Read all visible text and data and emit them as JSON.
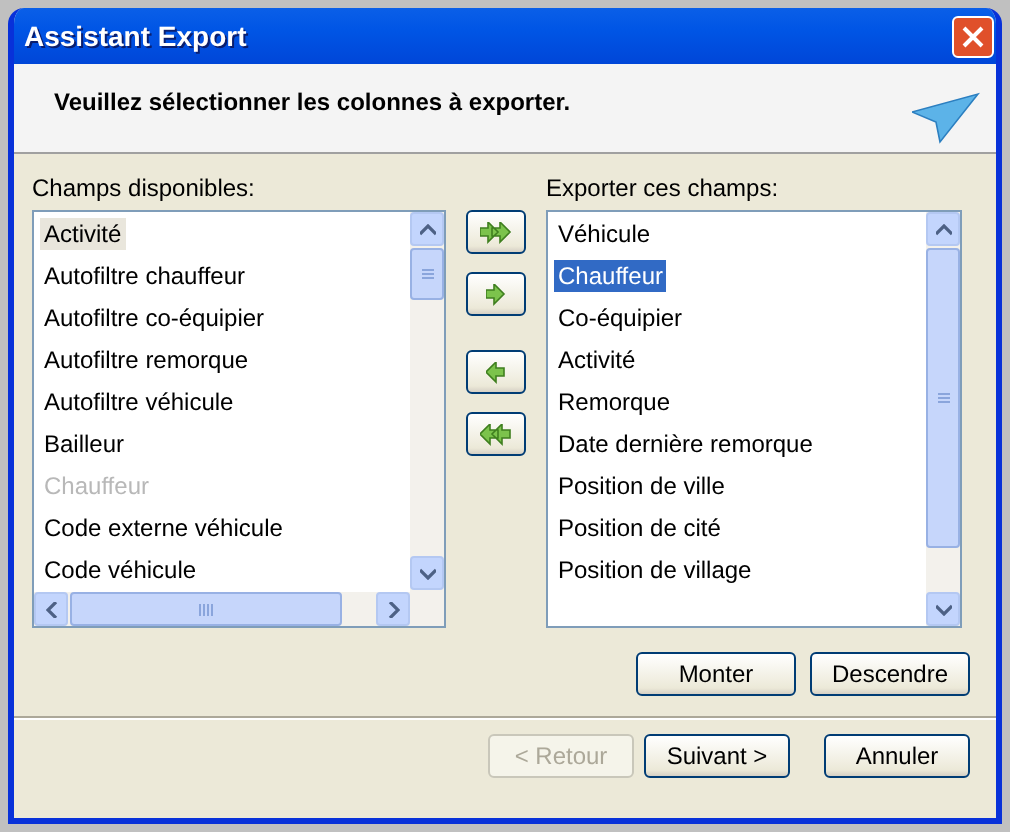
{
  "window": {
    "title": "Assistant Export"
  },
  "header": {
    "instruction": "Veuillez sélectionner les colonnes à exporter."
  },
  "available": {
    "label": "Champs disponibles:",
    "items": [
      {
        "text": "Activité",
        "selected": true,
        "disabled": false
      },
      {
        "text": "Autofiltre chauffeur",
        "selected": false,
        "disabled": false
      },
      {
        "text": "Autofiltre co-équipier",
        "selected": false,
        "disabled": false
      },
      {
        "text": "Autofiltre remorque",
        "selected": false,
        "disabled": false
      },
      {
        "text": "Autofiltre véhicule",
        "selected": false,
        "disabled": false
      },
      {
        "text": "Bailleur",
        "selected": false,
        "disabled": false
      },
      {
        "text": "Chauffeur",
        "selected": false,
        "disabled": true
      },
      {
        "text": "Code externe véhicule",
        "selected": false,
        "disabled": false
      },
      {
        "text": "Code véhicule",
        "selected": false,
        "disabled": false
      }
    ]
  },
  "exported": {
    "label": "Exporter ces champs:",
    "items": [
      {
        "text": "Véhicule",
        "selected": false
      },
      {
        "text": "Chauffeur",
        "selected": true
      },
      {
        "text": "Co-équipier",
        "selected": false
      },
      {
        "text": "Activité",
        "selected": false
      },
      {
        "text": "Remorque",
        "selected": false
      },
      {
        "text": "Date dernière remorque",
        "selected": false
      },
      {
        "text": "Position de ville",
        "selected": false
      },
      {
        "text": "Position de cité",
        "selected": false
      },
      {
        "text": "Position de village",
        "selected": false
      }
    ]
  },
  "order_buttons": [
    "Monter",
    "Descendre"
  ],
  "nav_buttons": [
    {
      "label": "< Retour",
      "disabled": true
    },
    {
      "label": "Suivant >",
      "disabled": false
    },
    {
      "label": "Annuler",
      "disabled": false
    }
  ]
}
